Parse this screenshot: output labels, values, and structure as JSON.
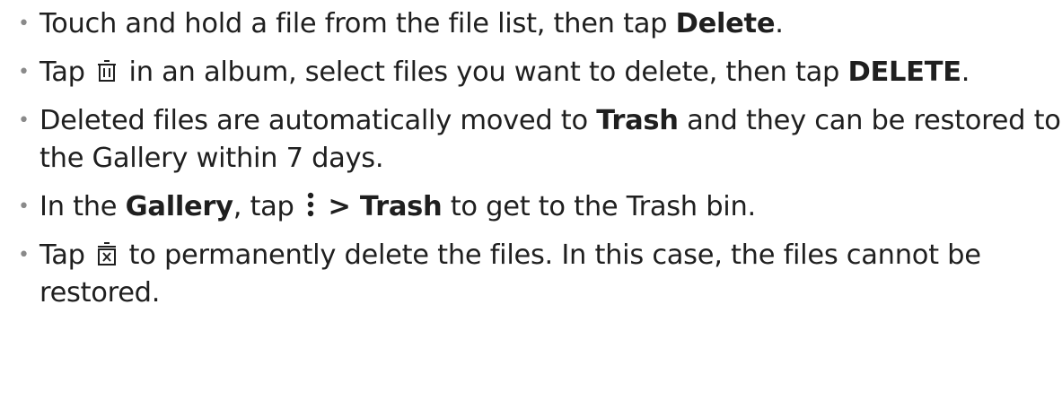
{
  "bullet_char": "•",
  "items": [
    {
      "text_before": "Touch and hold a file from the file list, then tap ",
      "bold": "Delete",
      "text_after": "."
    },
    {
      "text_before": "Tap ",
      "icon": "trash-icon",
      "text_middle": " in an album, select files you want to delete, then tap ",
      "bold": "DELETE",
      "text_after": "."
    },
    {
      "text_before": "Deleted files are automatically moved to ",
      "bold": "Trash",
      "text_after": " and they can be restored to the Gallery within 7 days."
    },
    {
      "text_before": "In the ",
      "bold_1": "Gallery",
      "text_middle": ", tap ",
      "icon": "more-options-icon",
      "separator": " > ",
      "bold_2": "Trash",
      "text_after": " to get to the Trash bin."
    },
    {
      "text_before": "Tap ",
      "icon": "delete-permanently-icon",
      "text_after": " to permanently delete the files. In this case, the files cannot be restored."
    }
  ]
}
